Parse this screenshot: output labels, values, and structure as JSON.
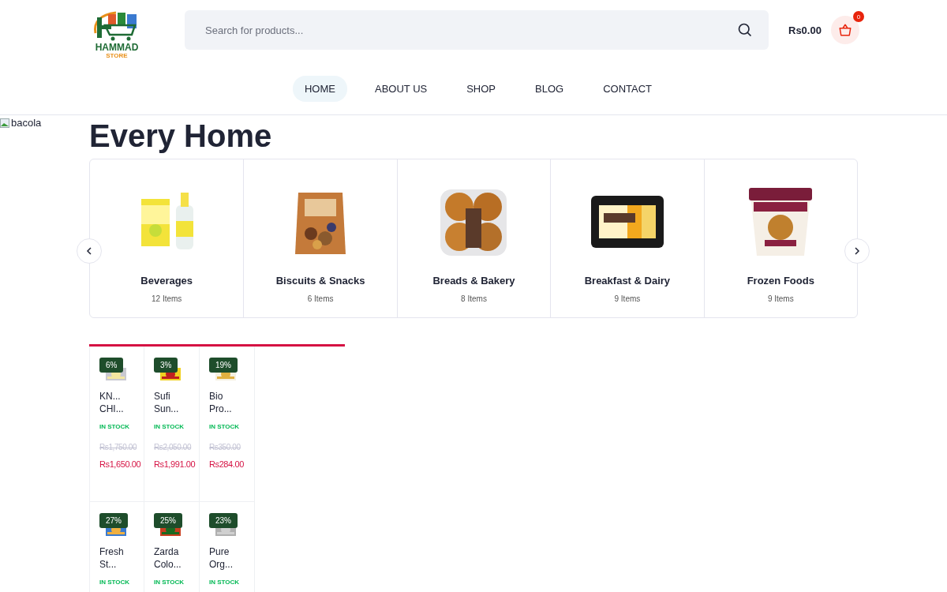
{
  "header": {
    "logo": {
      "name": "HAMMAD",
      "subtitle": "STORE"
    },
    "search": {
      "placeholder": "Search for products..."
    },
    "cart": {
      "total": "Rs0.00",
      "count": "0"
    }
  },
  "nav": [
    {
      "label": "HOME",
      "selected": true
    },
    {
      "label": "ABOUT US",
      "selected": false
    },
    {
      "label": "SHOP",
      "selected": false
    },
    {
      "label": "BLOG",
      "selected": false
    },
    {
      "label": "CONTACT",
      "selected": false
    }
  ],
  "hero": {
    "heading": "Every Home",
    "image_alt": "bacola"
  },
  "categories": [
    {
      "name": "Beverages",
      "count": "12 Items",
      "kind": "bottle"
    },
    {
      "name": "Biscuits & Snacks",
      "count": "6 Items",
      "kind": "pouch"
    },
    {
      "name": "Breads & Bakery",
      "count": "8 Items",
      "kind": "muffins"
    },
    {
      "name": "Breakfast & Dairy",
      "count": "9 Items",
      "kind": "tray"
    },
    {
      "name": "Frozen Foods",
      "count": "9 Items",
      "kind": "tub"
    }
  ],
  "products": [
    {
      "discount": "6%",
      "name": "KN... CHI...",
      "stock": "IN STOCK",
      "old_price": "Rs1,750.00",
      "price": "Rs1,650.00"
    },
    {
      "discount": "3%",
      "name": "Sufi Sun...",
      "stock": "IN STOCK",
      "old_price": "Rs2,050.00",
      "price": "Rs1,991.00"
    },
    {
      "discount": "19%",
      "name": "Bio Pro...",
      "stock": "IN STOCK",
      "old_price": "Rs350.00",
      "price": "Rs284.00"
    },
    {
      "discount": "27%",
      "name": "Fresh St...",
      "stock": "IN STOCK"
    },
    {
      "discount": "25%",
      "name": "Zarda Colo...",
      "stock": "IN STOCK"
    },
    {
      "discount": "23%",
      "name": "Pure Org...",
      "stock": "IN STOCK"
    }
  ]
}
